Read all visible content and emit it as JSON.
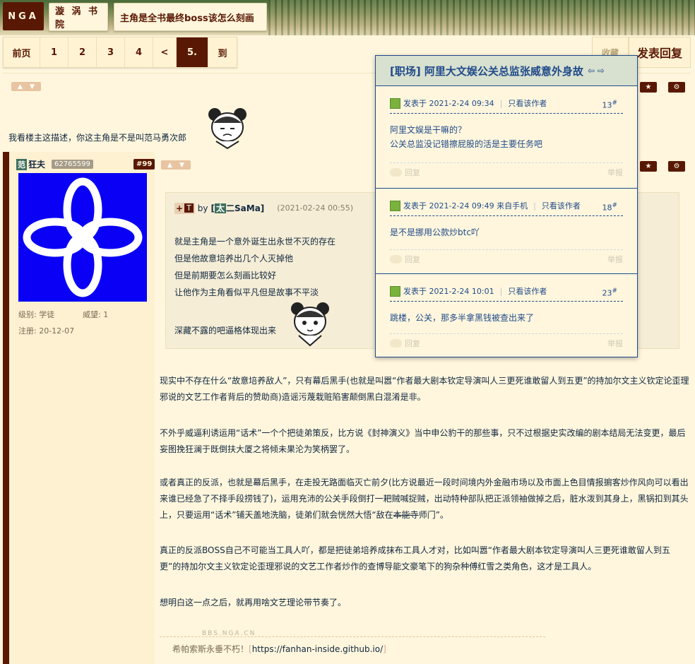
{
  "header": {
    "logo": "NGA",
    "forum": "漩 涡 书 院",
    "thread_title": "主角是全书最终boss该怎么刻画"
  },
  "pager": {
    "first": "前页",
    "pages": [
      "1",
      "2",
      "3",
      "4"
    ],
    "prev": "<",
    "current": "5.",
    "goto": "到"
  },
  "actions": {
    "favorite": "收藏",
    "reply": "发表回复"
  },
  "post1": {
    "text": "我看楼主这描述，你这主角是不是叫范马勇次郎"
  },
  "post2": {
    "user_badge": "范",
    "username": "狂夫",
    "uid": "62765599",
    "floor": "#99",
    "level": "级别: 学徒",
    "prestige": "威望: 1",
    "registered": "注册: 20-12-07",
    "quote": {
      "plus": "+",
      "tag": "T",
      "by": "by",
      "author_badge": "太",
      "author": "二SaMa",
      "date": "(2021-02-24 00:55)",
      "lines": [
        "就是主角是一个意外诞生出永世不灭的存在",
        "但是他故意培养出几个人灭掉他",
        "但是前期要怎么刻画比较好",
        "让他作为主角看似平凡但是故事不平淡",
        "深藏不露的吧逼格体现出来"
      ]
    },
    "paragraphs": [
      "现实中不存在什么“故意培养敌人”，只有幕后黑手(也就是叫嚣“作者最大剧本钦定导演叫人三更死谁敢留人到五更”的持加尔文主义钦定论歪理邪说的文艺工作者背后的赞助商)造谣污蔑栽赃陷害颠倒黑白混淆是非。",
      "不外乎威逼利诱运用“话术”一个个把徒弟策反，比方说《封神演义》当中申公豹干的那些事，只不过根据史实改编的剧本结局无法变更，最后妄图挽狂澜于既倒扶大厦之将倾未果沦为笑柄罢了。",
      "或者真正的反派，也就是幕后黑手，在走投无路面临灭亡前夕(比方说最近一段时间境内外金融市场以及市面上色目情报掮客炒作风向可以看出来谁已经急了不择手段捞钱了)，运用充沛的公关手段倒打一耙贼喊捉贼，出动特种部队把正派领袖做掉之后，脏水泼到其身上，黑锅扣到其头上，只要运用“话术”铺天盖地洗脑，徒弟们就会恍然大悟“",
      "真正的反派BOSS自己不可能当工具人吖，都是把徒弟培养成抹布工具人才对，比如叫嚣“作者最大剧本钦定导演叫人三更死谁敢留人到五更”的持加尔文主义钦定论歪理邪说的文艺工作者炒作的查博导能文豪笔下的狗杂种傅红雪之类角色，这才是工具人。",
      "想明白这一点之后，就再用啥文艺理论带节奏了。"
    ],
    "para3_tail_plain": "敌在",
    "para3_tail_strike": "本能寺",
    "para3_tail_end": "师门”。",
    "watermark": "BBS.NGA.CN",
    "signature_text": "希帕索斯永垂不朽！",
    "signature_bracket_open": "[",
    "signature_url": "https://fanhan-inside.github.io/",
    "signature_bracket_close": "]"
  },
  "popup": {
    "title": "[职场] 阿里大文娱公关总监张威意外身故",
    "arrows": "⇦ ⇨",
    "items": [
      {
        "posted": "发表于 2021-2-24 09:34",
        "author_only": "只看该作者",
        "floor": "13",
        "floor_mark": "#",
        "lines": [
          "阿里文娱是干嘛的？",
          "公关总监没记错擦屁股的活是主要任务吧"
        ],
        "reply": "回复",
        "report": "举报"
      },
      {
        "posted": "发表于 2021-2-24 09:49 来自手机",
        "author_only": "只看该作者",
        "floor": "18",
        "floor_mark": "#",
        "lines": [
          "是不是挪用公款炒btc吖"
        ],
        "reply": "回复",
        "report": "举报"
      },
      {
        "posted": "发表于 2021-2-24 10:01",
        "author_only": "只看该作者",
        "floor": "23",
        "floor_mark": "#",
        "lines": [
          "跳楼，公关，那多半拿黑钱被查出来了"
        ],
        "reply": "回复",
        "report": "举报"
      }
    ]
  },
  "icons": {
    "thumb_up": "thumb-up-icon",
    "thumb_down": "thumb-down-icon",
    "star": "star-icon",
    "gear": "gear-icon",
    "user_post": "user-post-icon",
    "reply_bubble": "reply-bubble-icon"
  },
  "colors": {
    "brand": "#591804",
    "background": "#fff6dd",
    "text": "#10273f",
    "popup_accent": "#1f4a8a"
  }
}
